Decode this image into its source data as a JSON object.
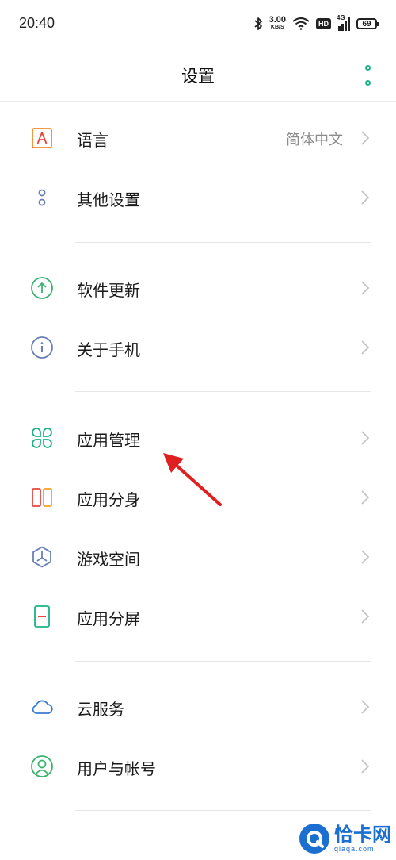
{
  "status_bar": {
    "time": "20:40",
    "net_speed_value": "3.00",
    "net_speed_unit": "KB/S",
    "hd_label": "HD",
    "network_type": "4G",
    "battery_level": "69"
  },
  "header": {
    "title": "设置"
  },
  "rows": [
    {
      "label": "语言",
      "value": "简体中文",
      "icon": "language-icon"
    },
    {
      "label": "其他设置",
      "icon": "other-settings-icon"
    },
    {
      "label": "软件更新",
      "icon": "software-update-icon"
    },
    {
      "label": "关于手机",
      "icon": "about-phone-icon"
    },
    {
      "label": "应用管理",
      "icon": "app-management-icon"
    },
    {
      "label": "应用分身",
      "icon": "app-clone-icon"
    },
    {
      "label": "游戏空间",
      "icon": "game-space-icon"
    },
    {
      "label": "应用分屏",
      "icon": "split-screen-icon"
    },
    {
      "label": "云服务",
      "icon": "cloud-service-icon"
    },
    {
      "label": "用户与帐号",
      "icon": "users-accounts-icon"
    }
  ],
  "watermark": {
    "name": "恰卡网",
    "url": "qiaqa.com"
  },
  "colors": {
    "accent": "#1bb28a",
    "annotation_arrow": "#e02020"
  }
}
